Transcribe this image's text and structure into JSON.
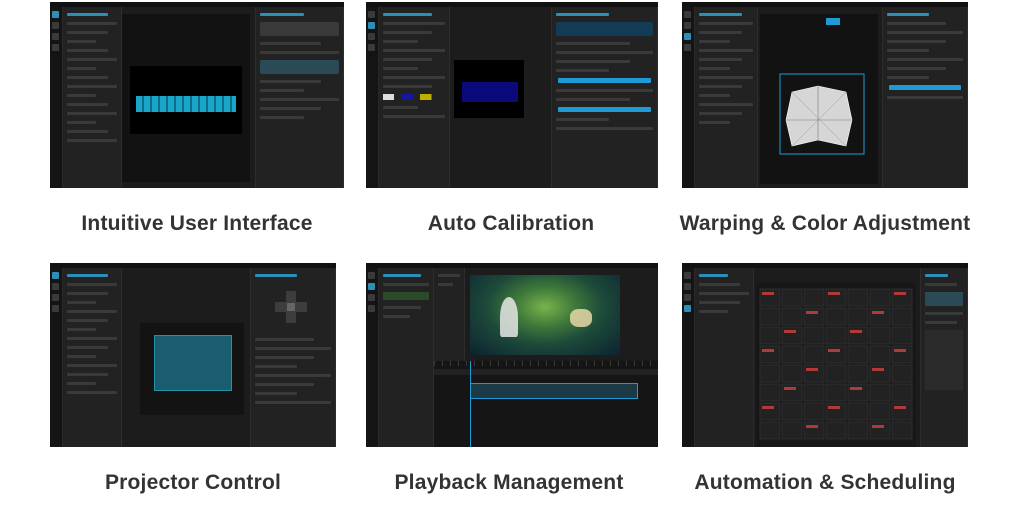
{
  "tiles": [
    {
      "caption": "Intuitive User Interface"
    },
    {
      "caption": "Auto Calibration"
    },
    {
      "caption": "Warping & Color Adjustment"
    },
    {
      "caption": "Projector Control"
    },
    {
      "caption": "Playback Management"
    },
    {
      "caption": "Automation & Scheduling"
    }
  ],
  "colors": {
    "app_background": "#1c1c1c",
    "accent_blue": "#1e9ad6",
    "caption_text": "#333333"
  }
}
